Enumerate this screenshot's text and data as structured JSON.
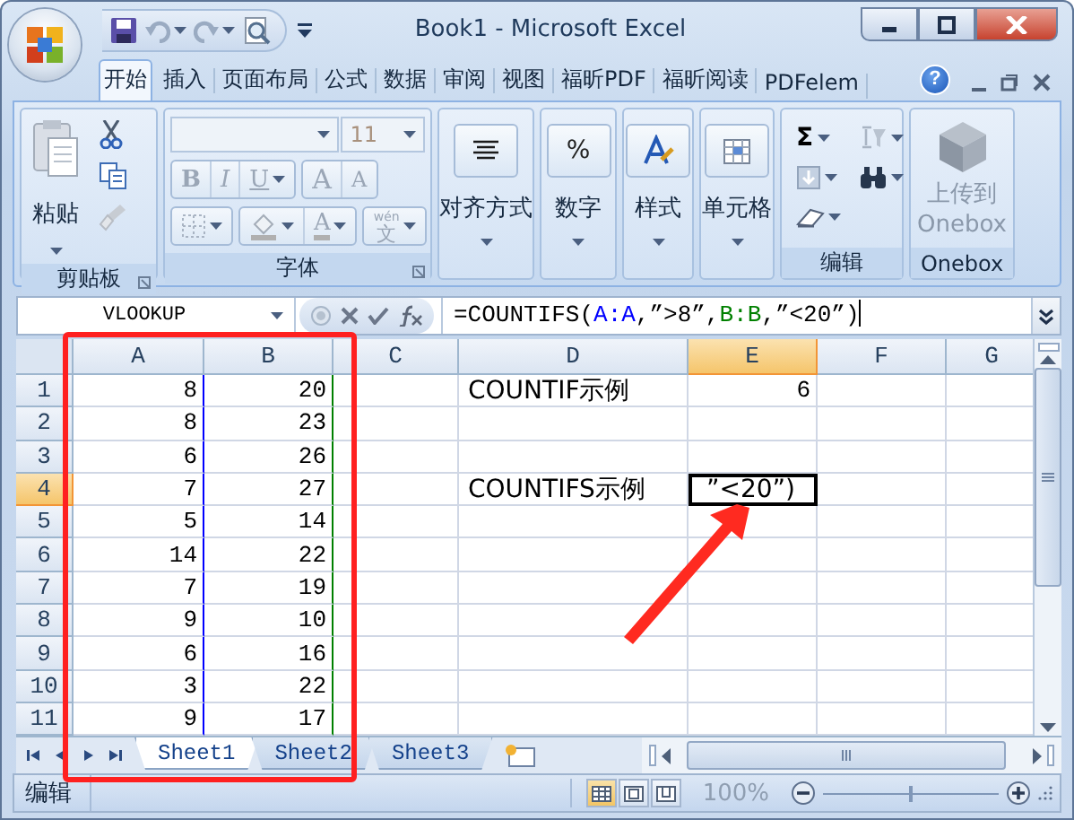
{
  "window": {
    "title": "Book1 - Microsoft Excel"
  },
  "tabs": [
    {
      "label": "开始",
      "selected": true
    },
    {
      "label": "插入",
      "selected": false
    },
    {
      "label": "页面布局",
      "selected": false
    },
    {
      "label": "公式",
      "selected": false
    },
    {
      "label": "数据",
      "selected": false
    },
    {
      "label": "审阅",
      "selected": false
    },
    {
      "label": "视图",
      "selected": false
    },
    {
      "label": "福昕PDF",
      "selected": false
    },
    {
      "label": "福昕阅读",
      "selected": false
    },
    {
      "label": "PDFelem",
      "selected": false
    }
  ],
  "help_label": "?",
  "ribbon": {
    "clipboard": {
      "paste": "粘贴",
      "label": "剪贴板"
    },
    "font": {
      "size": "11",
      "bold": "B",
      "italic": "I",
      "underline": "U",
      "grow": "A",
      "shrink": "A",
      "font_color": "A",
      "phonetic": "wén",
      "phonetic_char": "文",
      "label": "字体",
      "disabled": true
    },
    "collapsed_groups": [
      {
        "label": "对齐方式",
        "kind": "align"
      },
      {
        "label": "数字",
        "kind": "number",
        "glyph": "%"
      },
      {
        "label": "样式",
        "kind": "styles"
      },
      {
        "label": "单元格",
        "kind": "cells"
      }
    ],
    "editing": {
      "autosum": "Σ",
      "label": "编辑"
    },
    "onebox": {
      "button": "上传到 Onebox",
      "label": "Onebox",
      "disabled": true
    }
  },
  "formula_bar": {
    "name_box": "VLOOKUP",
    "segments": [
      {
        "text": "=COUNTIFS(",
        "color": "#000000"
      },
      {
        "text": "A:A",
        "color": "#0000ff"
      },
      {
        "text": ",”>8”,",
        "color": "#000000"
      },
      {
        "text": "B:B",
        "color": "#008000"
      },
      {
        "text": ",”<20”)",
        "color": "#000000"
      }
    ]
  },
  "columns": [
    {
      "label": "A",
      "selected": false,
      "color": "#0000ff"
    },
    {
      "label": "B",
      "selected": false,
      "color": "#008000"
    },
    {
      "label": "C",
      "selected": false
    },
    {
      "label": "D",
      "selected": false
    },
    {
      "label": "E",
      "selected": true
    },
    {
      "label": "F",
      "selected": false
    },
    {
      "label": "G",
      "selected": false
    }
  ],
  "rows": [
    {
      "header": "1",
      "selected": false,
      "cells": {
        "a": {
          "text": "8",
          "kind": "number"
        },
        "b": {
          "text": "20",
          "kind": "number"
        },
        "d": {
          "text": "COUNTIF示例",
          "kind": "text"
        },
        "e": {
          "text": "6",
          "kind": "number"
        }
      }
    },
    {
      "header": "2",
      "selected": false,
      "cells": {
        "a": {
          "text": "8",
          "kind": "number"
        },
        "b": {
          "text": "23",
          "kind": "number"
        }
      }
    },
    {
      "header": "3",
      "selected": false,
      "cells": {
        "a": {
          "text": "6",
          "kind": "number"
        },
        "b": {
          "text": "26",
          "kind": "number"
        }
      }
    },
    {
      "header": "4",
      "selected": true,
      "cells": {
        "a": {
          "text": "7",
          "kind": "number"
        },
        "b": {
          "text": "27",
          "kind": "number"
        },
        "d": {
          "text": "COUNTIFS示例",
          "kind": "text"
        },
        "e": {
          "text": "”<20”)",
          "kind": "text"
        }
      }
    },
    {
      "header": "5",
      "selected": false,
      "cells": {
        "a": {
          "text": "5",
          "kind": "number"
        },
        "b": {
          "text": "14",
          "kind": "number"
        }
      }
    },
    {
      "header": "6",
      "selected": false,
      "cells": {
        "a": {
          "text": "14",
          "kind": "number"
        },
        "b": {
          "text": "22",
          "kind": "number"
        }
      }
    },
    {
      "header": "7",
      "selected": false,
      "cells": {
        "a": {
          "text": "7",
          "kind": "number"
        },
        "b": {
          "text": "19",
          "kind": "number"
        }
      }
    },
    {
      "header": "8",
      "selected": false,
      "cells": {
        "a": {
          "text": "9",
          "kind": "number"
        },
        "b": {
          "text": "10",
          "kind": "number"
        }
      }
    },
    {
      "header": "9",
      "selected": false,
      "cells": {
        "a": {
          "text": "6",
          "kind": "number"
        },
        "b": {
          "text": "16",
          "kind": "number"
        }
      }
    },
    {
      "header": "10",
      "selected": false,
      "cells": {
        "a": {
          "text": "3",
          "kind": "number"
        },
        "b": {
          "text": "22",
          "kind": "number"
        }
      }
    },
    {
      "header": "11",
      "selected": false,
      "cells": {
        "a": {
          "text": "9",
          "kind": "number"
        },
        "b": {
          "text": "17",
          "kind": "number"
        }
      }
    }
  ],
  "sheet_tabs": [
    {
      "label": "Sheet1",
      "selected": true
    },
    {
      "label": "Sheet2",
      "selected": false
    },
    {
      "label": "Sheet3",
      "selected": false
    }
  ],
  "status_bar": {
    "mode": "编辑",
    "zoom": "100%",
    "level": 0.5
  }
}
